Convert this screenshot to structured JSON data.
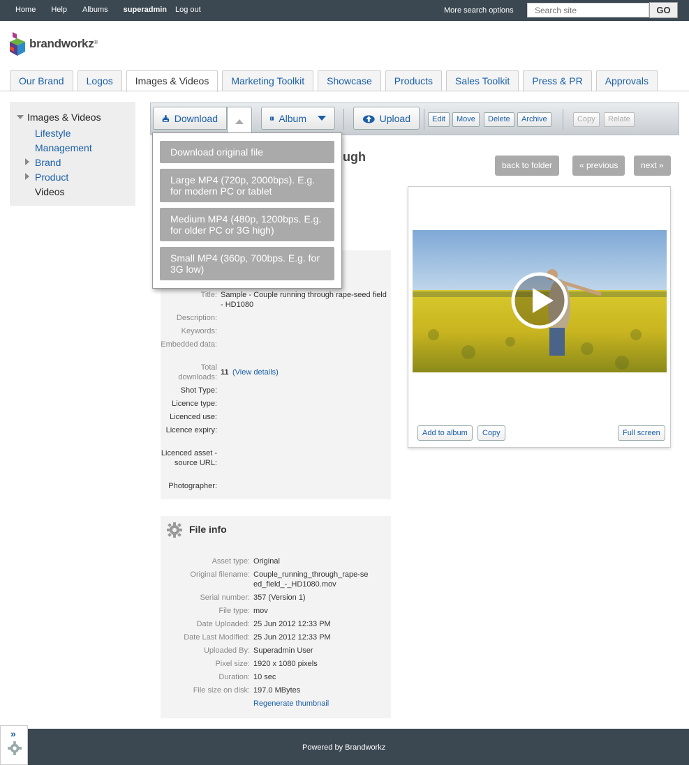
{
  "topnav": {
    "home": "Home",
    "help": "Help",
    "albums": "Albums",
    "user": "superadmin",
    "logout": "Log out",
    "more_search": "More search options",
    "search_placeholder": "Search site",
    "go": "GO"
  },
  "logo": {
    "text": "brandworkz"
  },
  "tabs": [
    {
      "label": "Our Brand"
    },
    {
      "label": "Logos"
    },
    {
      "label": "Images & Videos"
    },
    {
      "label": "Marketing Toolkit"
    },
    {
      "label": "Showcase"
    },
    {
      "label": "Products"
    },
    {
      "label": "Sales Toolkit"
    },
    {
      "label": "Press & PR"
    },
    {
      "label": "Approvals"
    }
  ],
  "sidebar": {
    "root": "Images & Videos",
    "items": [
      {
        "label": "Lifestyle"
      },
      {
        "label": "Management"
      },
      {
        "label": "Brand"
      },
      {
        "label": "Product"
      },
      {
        "label": "Videos"
      }
    ]
  },
  "toolbar": {
    "download": "Download",
    "album": "Album",
    "upload": "Upload",
    "edit": "Edit",
    "move": "Move",
    "delete": "Delete",
    "archive": "Archive",
    "copy": "Copy",
    "relate": "Relate"
  },
  "dropdown": [
    "Download original file",
    "Large MP4 (720p, 2000bps). E.g. for modern PC or tablet",
    "Medium MP4 (480p, 1200bps. E.g. for older PC or 3G high)",
    "Small MP4 (360p, 700bps. E.g. for 3G low)"
  ],
  "title_fragment": "ugh",
  "nav": {
    "back": "back to folder",
    "previous": "«  previous",
    "next": "next »"
  },
  "preview": {
    "add_album": "Add to album",
    "copy": "Copy",
    "fullscreen": "Full screen"
  },
  "metadata": {
    "title_label": "Title:",
    "title_value": "Sample - Couple running through rape-seed field - HD1080",
    "description_label": "Description:",
    "keywords_label": "Keywords:",
    "embedded_label": "Embedded data:",
    "downloads_label": "Total downloads:",
    "downloads_value": "11",
    "view_details": "(View details)",
    "shot_label": "Shot Type:",
    "licence_type_label": "Licence type:",
    "licenced_use_label": "Licenced use:",
    "licence_expiry_label": "Licence expiry:",
    "licenced_asset_label": "Licenced asset - source URL:",
    "photographer_label": "Photographer:"
  },
  "fileinfo": {
    "heading": "File info",
    "rows": [
      {
        "label": "Asset type:",
        "value": "Original"
      },
      {
        "label": "Original filename:",
        "value": "Couple_running_through_rape-seed_field_-_HD1080.mov"
      },
      {
        "label": "Serial number:",
        "value": "357 (Version 1)"
      },
      {
        "label": "File type:",
        "value": "mov"
      },
      {
        "label": "Date Uploaded:",
        "value": "25 Jun 2012  12:33 PM"
      },
      {
        "label": "Date Last Modified:",
        "value": "25 Jun 2012  12:33 PM"
      },
      {
        "label": "Uploaded By:",
        "value": "Superadmin User"
      },
      {
        "label": "Pixel size:",
        "value": "1920 x 1080 pixels"
      },
      {
        "label": "Duration:",
        "value": "10 sec"
      },
      {
        "label": "File size on disk:",
        "value": "197.0 MBytes"
      }
    ],
    "regenerate": "Regenerate thumbnail"
  },
  "footer": {
    "text": "Powered by Brandworkz"
  },
  "colors": {
    "topbar": "#3b4751",
    "link": "#1a5fa8",
    "button_grey": "#aaaaaa"
  }
}
